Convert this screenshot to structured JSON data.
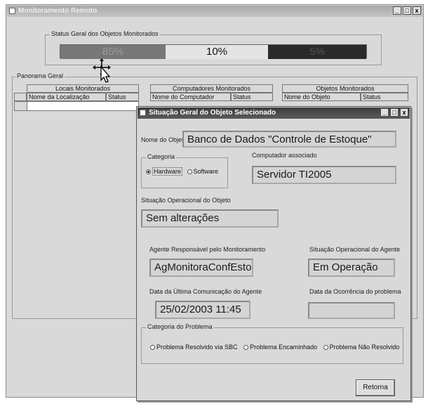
{
  "main_window": {
    "title": "Monitoramento Remoto",
    "controls": [
      "_",
      "□",
      "x"
    ],
    "status_group": {
      "label": "Status Geral dos Objetos Monitorados",
      "segments": [
        {
          "text": "85%",
          "color": "#777777",
          "text_color": "#999999"
        },
        {
          "text": "10%",
          "color": "#e4e4e4",
          "text_color": "#111111"
        },
        {
          "text": "5%",
          "color": "#2a2a2a",
          "text_color": "#555555"
        }
      ]
    },
    "overview_group": {
      "label": "Panorama Geral",
      "tables": [
        {
          "title": "Locais Monitorados",
          "columns": [
            "Nome da Localização",
            "Status"
          ]
        },
        {
          "title": "Computadores Monitorados",
          "columns": [
            "Nome do Computador",
            "Status"
          ]
        },
        {
          "title": "Objetos Monitorados",
          "columns": [
            "Nome do Objeto",
            "Status"
          ]
        }
      ]
    }
  },
  "detail_window": {
    "title": "Situação Geral do Objeto Selecionado",
    "controls": [
      "_",
      "□",
      "x"
    ],
    "object_name_label": "Nome do Objeto",
    "object_name_value": "Banco de Dados \"Controle de Estoque\"",
    "category": {
      "label": "Categoria",
      "options": [
        {
          "label": "Hardware",
          "selected": true
        },
        {
          "label": "Software",
          "selected": false
        }
      ]
    },
    "computer_label": "Computador associado",
    "computer_value": "Servidor TI2005",
    "op_status_label": "Situação Operacional do Objeto",
    "op_status_value": "Sem alterações",
    "agent_label": "Agente Responsável pelo Monitoramento",
    "agent_value": "AgMonitoraConfEstoque",
    "agent_status_label": "Situação Operacional do Agente",
    "agent_status_value": "Em Operação",
    "last_comm_label": "Data da Última Comunicação do Agente",
    "last_comm_value": "25/02/2003 11:45",
    "occurrence_label": "Data da Ocorrência do problema",
    "occurrence_value": "",
    "problem_category": {
      "label": "Categoria do Problema",
      "options": [
        {
          "label": "Problema Resolvido via SBC",
          "selected": false
        },
        {
          "label": "Problema Encaminhado",
          "selected": false
        },
        {
          "label": "Problema Não Resolvido",
          "selected": false
        }
      ]
    },
    "return_button": "Retorna"
  },
  "cursor": {
    "icon": "move-cursor-icon"
  }
}
